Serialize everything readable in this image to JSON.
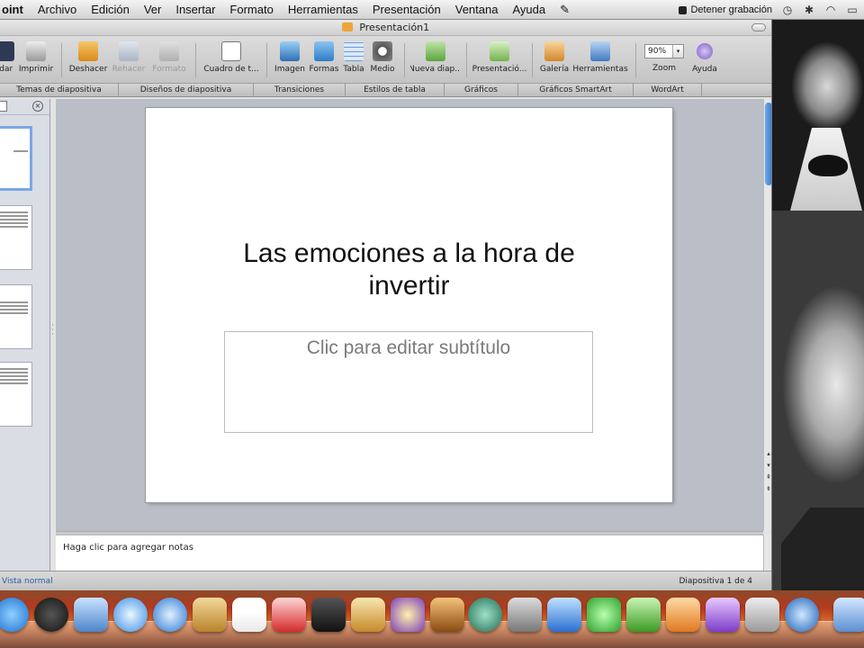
{
  "menubar": {
    "app_name": "oint",
    "menus": [
      "Archivo",
      "Edición",
      "Ver",
      "Insertar",
      "Formato",
      "Herramientas",
      "Presentación",
      "Ventana",
      "Ayuda"
    ],
    "record_label": "Detener grabación"
  },
  "window": {
    "title": "Presentación1"
  },
  "toolbar": {
    "buttons": [
      {
        "label": "rdar",
        "icon": "save-icon",
        "enabled": true
      },
      {
        "label": "Imprimir",
        "icon": "print-icon",
        "enabled": true
      },
      {
        "label": "Deshacer",
        "icon": "undo-icon",
        "enabled": true
      },
      {
        "label": "Rehacer",
        "icon": "redo-icon",
        "enabled": false
      },
      {
        "label": "Formato",
        "icon": "format-brush-icon",
        "enabled": false
      },
      {
        "label": "Cuadro de t...",
        "icon": "textbox-icon",
        "enabled": true
      },
      {
        "label": "Imagen",
        "icon": "image-icon",
        "enabled": true
      },
      {
        "label": "Formas",
        "icon": "shapes-icon",
        "enabled": true
      },
      {
        "label": "Tabla",
        "icon": "table-icon",
        "enabled": true
      },
      {
        "label": "Medio",
        "icon": "media-icon",
        "enabled": true
      },
      {
        "label": "Nueva diap...",
        "icon": "new-slide-icon",
        "enabled": true
      },
      {
        "label": "Presentació...",
        "icon": "slideshow-icon",
        "enabled": true
      },
      {
        "label": "Galería",
        "icon": "gallery-icon",
        "enabled": true
      },
      {
        "label": "Herramientas",
        "icon": "toolbox-icon",
        "enabled": true
      },
      {
        "label": "Zoom",
        "icon": "zoom-icon",
        "enabled": true
      },
      {
        "label": "Ayuda",
        "icon": "help-icon",
        "enabled": true
      }
    ],
    "zoom_value": "90%"
  },
  "ribbon_tabs": [
    "Temas de diapositiva",
    "Diseños de diapositiva",
    "Transiciones",
    "Estilos de tabla",
    "Gráficos",
    "Gráficos SmartArt",
    "WordArt"
  ],
  "slide": {
    "title": "Las emociones a la hora de invertir",
    "subtitle_placeholder": "Clic para editar subtítulo"
  },
  "notes": {
    "placeholder": "Haga clic para agregar notas"
  },
  "statusbar": {
    "view": "Vista normal",
    "slide_counter": "Diapositiva 1 de 4"
  },
  "dock": {
    "icons": [
      "app-store-icon",
      "dashboard-icon",
      "preview-icon",
      "safari-icon",
      "facetime-icon",
      "address-book-icon",
      "calendar-icon",
      "photo-booth-icon",
      "dvd-player-icon",
      "iphoto-icon",
      "imovie-icon",
      "garageband-icon",
      "time-machine-icon",
      "boot-camp-icon",
      "word-icon",
      "messenger-icon",
      "excel-icon",
      "powerpoint-icon",
      "entourage-icon",
      "system-preferences-icon",
      "quicktime-icon",
      "downloads-stack-icon"
    ]
  }
}
